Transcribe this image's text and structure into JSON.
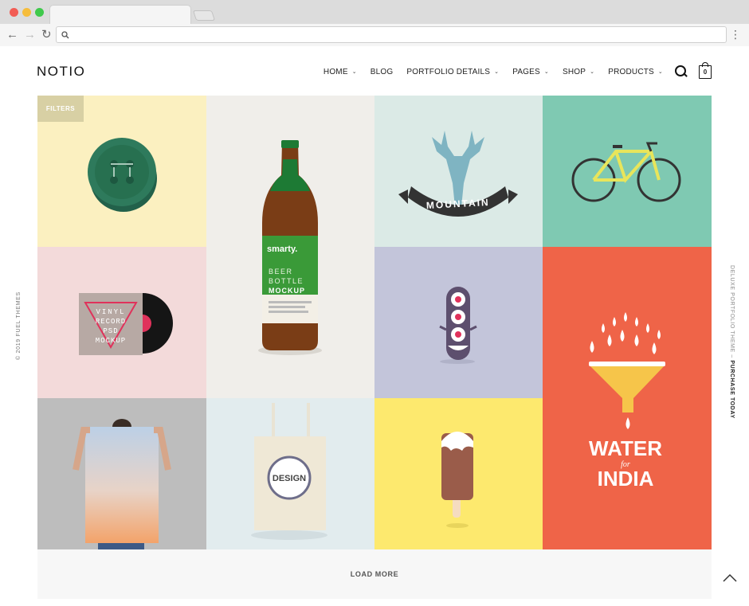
{
  "browser": {
    "icons": [
      "back-arrow-icon",
      "forward-arrow-icon",
      "reload-icon",
      "search-icon",
      "kebab-menu-icon"
    ]
  },
  "site": {
    "logo": "NOTIO",
    "nav": [
      {
        "label": "HOME",
        "dropdown": true
      },
      {
        "label": "BLOG",
        "dropdown": false
      },
      {
        "label": "PORTFOLIO DETAILS",
        "dropdown": true
      },
      {
        "label": "PAGES",
        "dropdown": true
      },
      {
        "label": "SHOP",
        "dropdown": true
      },
      {
        "label": "PRODUCTS",
        "dropdown": true
      }
    ],
    "cart_count": "0"
  },
  "portfolio": {
    "filters_label": "FILTERS",
    "load_more": "LOAD MORE",
    "tiles": [
      {
        "name": "button",
        "bg": "#fbf0c0"
      },
      {
        "name": "beer-bottle",
        "bg": "#f0eeea",
        "label_1": "smarty.",
        "label_2": "BEER",
        "label_3": "BOTTLE",
        "label_4": "MOCKUP"
      },
      {
        "name": "mountain",
        "bg": "#dbeae6",
        "text": "MOUNTAIN"
      },
      {
        "name": "bicycle",
        "bg": "#7fc9b2"
      },
      {
        "name": "vinyl",
        "bg": "#f3dada",
        "line_1": "VINYL",
        "line_2": "RECORD",
        "line_3": "PSD",
        "line_4": "MOCKUP"
      },
      {
        "name": "monster",
        "bg": "#c3c5da"
      },
      {
        "name": "water-india",
        "bg": "#ef6448",
        "line_1": "WATER",
        "line_2": "for",
        "line_3": "INDIA"
      },
      {
        "name": "poster",
        "bg": "#bdbdbd"
      },
      {
        "name": "tote-bag",
        "bg": "#e2ecee",
        "text": "DESIGN"
      },
      {
        "name": "popsicle",
        "bg": "#fde96e"
      }
    ]
  },
  "side": {
    "left": "© 2019 FUEL THEMES",
    "right_prefix": "DELUXE PORTFOLIO THEME – ",
    "right_cta": "PURCHASE TODAY"
  }
}
